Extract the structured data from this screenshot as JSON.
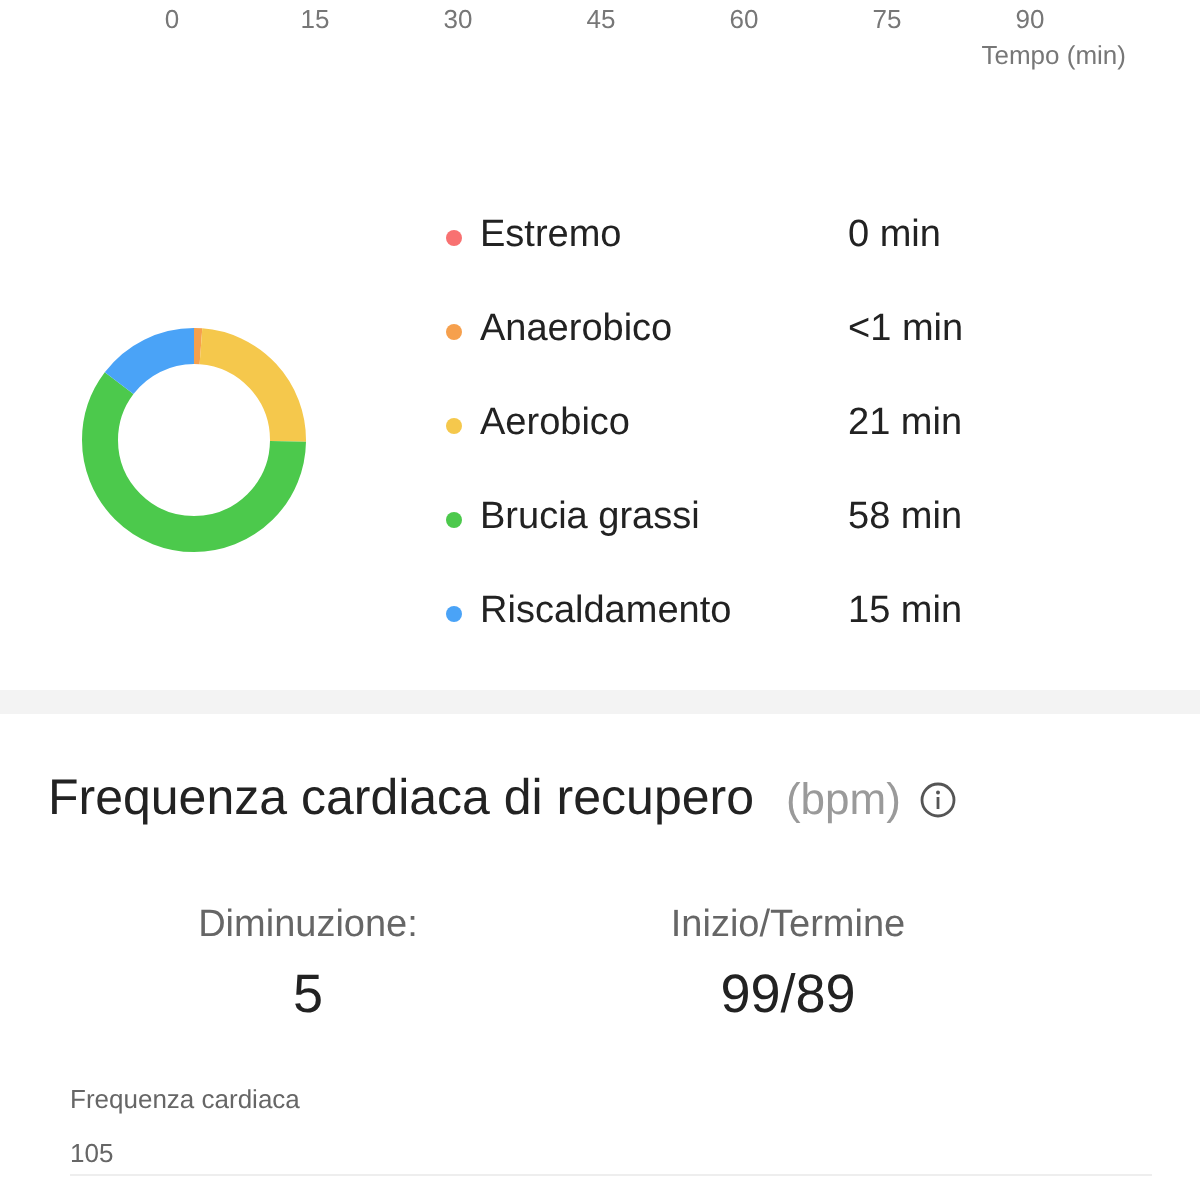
{
  "time_axis": {
    "ticks": [
      "0",
      "15",
      "30",
      "45",
      "60",
      "75",
      "90"
    ],
    "label": "Tempo (min)"
  },
  "zones": [
    {
      "name": "Estremo",
      "value": "0 min",
      "color": "#f87171"
    },
    {
      "name": "Anaerobico",
      "value": "<1 min",
      "color": "#f6a04d"
    },
    {
      "name": "Aerobico",
      "value": "21 min",
      "color": "#f5c84c"
    },
    {
      "name": "Brucia grassi",
      "value": "58 min",
      "color": "#4cc94c"
    },
    {
      "name": "Riscaldamento",
      "value": "15 min",
      "color": "#4aa3f7"
    }
  ],
  "recovery": {
    "title": "Frequenza cardiaca di recupero",
    "unit": "(bpm)",
    "stats": [
      {
        "label": "Diminuzione:",
        "value": "5"
      },
      {
        "label": "Inizio/Termine",
        "value": "99/89"
      }
    ],
    "chart_label": "Frequenza cardiaca",
    "y_ticks": [
      "105"
    ]
  }
}
